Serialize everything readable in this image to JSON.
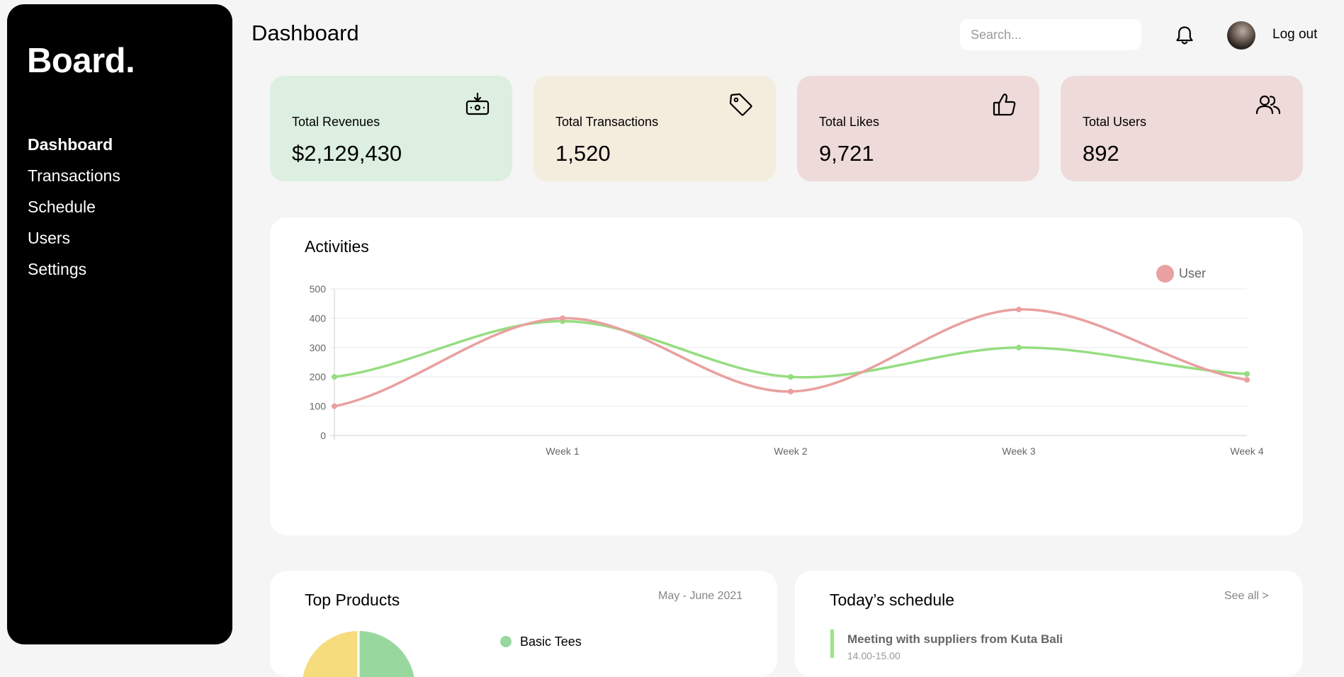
{
  "sidebar": {
    "logo": "Board.",
    "items": [
      {
        "label": "Dashboard",
        "active": true
      },
      {
        "label": "Transactions",
        "active": false
      },
      {
        "label": "Schedule",
        "active": false
      },
      {
        "label": "Users",
        "active": false
      },
      {
        "label": "Settings",
        "active": false
      }
    ]
  },
  "header": {
    "title": "Dashboard",
    "search_placeholder": "Search...",
    "search_value": "",
    "logout_label": "Log out",
    "notification_icon": "bell-icon"
  },
  "stats": [
    {
      "label": "Total Revenues",
      "value": "$2,129,430",
      "icon": "money-icon",
      "color": "#ddefe0"
    },
    {
      "label": "Total Transactions",
      "value": "1,520",
      "icon": "tag-icon",
      "color": "#f4ecdd"
    },
    {
      "label": "Total Likes",
      "value": "9,721",
      "icon": "thumbs-up-icon",
      "color": "#efdada"
    },
    {
      "label": "Total Users",
      "value": "892",
      "icon": "users-icon",
      "color": "#efdada"
    }
  ],
  "activities": {
    "title": "Activities",
    "legend": [
      {
        "label": "User",
        "color": "#e9a0a0"
      }
    ]
  },
  "chart_data": {
    "type": "line",
    "title": "Activities",
    "x": [
      "",
      "Week 1",
      "Week 2",
      "Week 3",
      "Week 4"
    ],
    "ylim": [
      0,
      500
    ],
    "yticks": [
      0,
      100,
      200,
      300,
      400,
      500
    ],
    "grid": true,
    "legend_position": "top-right",
    "series": [
      {
        "name": "User",
        "color": "#e9a0a0",
        "values": [
          100,
          400,
          150,
          430,
          190
        ]
      },
      {
        "color": "#96dd81",
        "values": [
          200,
          390,
          200,
          300,
          210
        ]
      }
    ]
  },
  "top_products": {
    "title": "Top Products",
    "date_range": "May - June 2021",
    "items": [
      {
        "name": "Basic Tees",
        "color": "#98d89e"
      }
    ],
    "pie_colors": [
      "#98d89e",
      "#f6dc7d"
    ]
  },
  "schedule": {
    "title": "Today’s schedule",
    "see_all": "See all >",
    "items": [
      {
        "title": "Meeting with suppliers from Kuta Bali",
        "time": "14.00-15.00",
        "color": "#9be38a"
      }
    ]
  }
}
